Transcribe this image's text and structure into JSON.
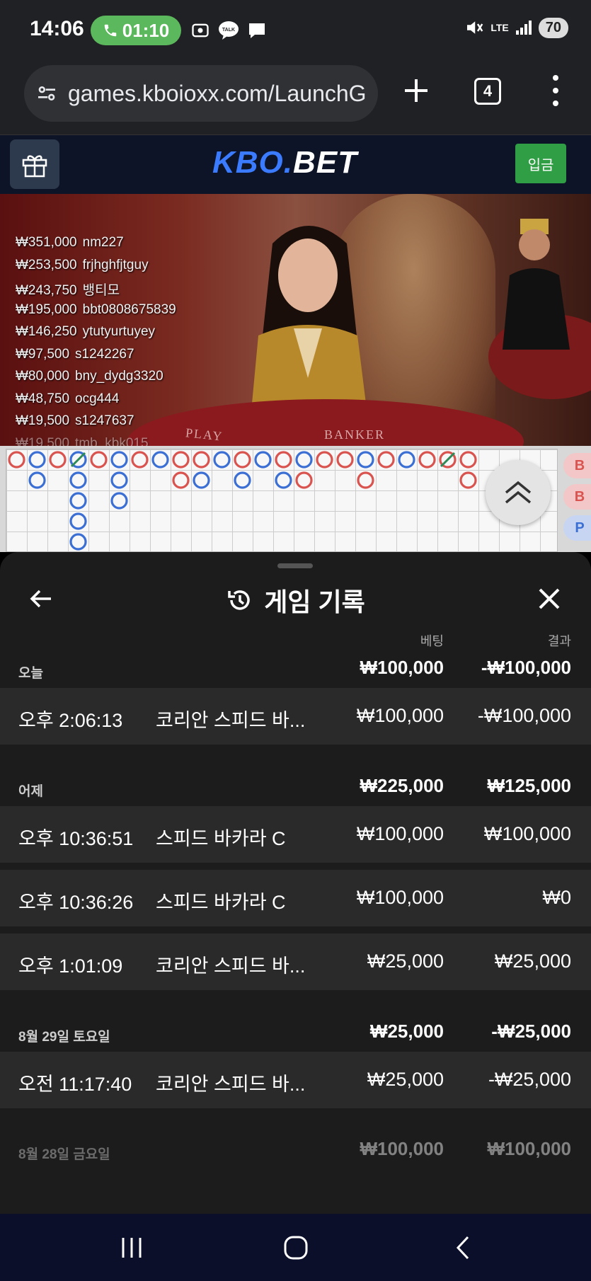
{
  "status_bar": {
    "time": "14:06",
    "call_timer": "01:10",
    "network": "LTE",
    "battery": "70"
  },
  "browser": {
    "url": "games.kboioxx.com/LaunchG",
    "tab_count": "4"
  },
  "site": {
    "logo_part1": "KBO.",
    "logo_part2": "BET",
    "deposit_label": "입금"
  },
  "video": {
    "bets": [
      {
        "amount": "₩351,000",
        "user": "nm227"
      },
      {
        "amount": "₩253,500",
        "user": "frjhghfjtguy"
      },
      {
        "amount": "₩243,750",
        "user": "뱅티모"
      },
      {
        "amount": "₩195,000",
        "user": "bbt0808675839"
      },
      {
        "amount": "₩146,250",
        "user": "ytutyurtuyey"
      },
      {
        "amount": "₩97,500",
        "user": "s1242267"
      },
      {
        "amount": "₩80,000",
        "user": "bny_dydg3320"
      },
      {
        "amount": "₩48,750",
        "user": "ocg444"
      },
      {
        "amount": "₩19,500",
        "user": "s1247637"
      },
      {
        "amount": "₩19,500",
        "user": "tmb_kbk015"
      }
    ],
    "player_label": "PLAY",
    "banker_label": "BANKER"
  },
  "road": {
    "side_pills": [
      {
        "label": "B",
        "color": "#d9534f"
      },
      {
        "label": "B",
        "color": "#d9534f"
      },
      {
        "label": "P",
        "color": "#3b6fd4"
      }
    ]
  },
  "history": {
    "title": "게임 기록",
    "col_bet": "베팅",
    "col_result": "결과",
    "groups": [
      {
        "label": "오늘",
        "bet": "₩100,000",
        "result": "-₩100,000",
        "rows": [
          {
            "time": "오후 2:06:13",
            "game": "코리안 스피드 바...",
            "bet": "₩100,000",
            "result": "-₩100,000"
          }
        ]
      },
      {
        "label": "어제",
        "bet": "₩225,000",
        "result": "₩125,000",
        "rows": [
          {
            "time": "오후 10:36:51",
            "game": "스피드 바카라 C",
            "bet": "₩100,000",
            "result": "₩100,000"
          },
          {
            "time": "오후 10:36:26",
            "game": "스피드 바카라 C",
            "bet": "₩100,000",
            "result": "₩0"
          },
          {
            "time": "오후 1:01:09",
            "game": "코리안 스피드 바...",
            "bet": "₩25,000",
            "result": "₩25,000"
          }
        ]
      },
      {
        "label": "8월 29일 토요일",
        "bet": "₩25,000",
        "result": "-₩25,000",
        "rows": [
          {
            "time": "오전 11:17:40",
            "game": "코리안 스피드 바...",
            "bet": "₩25,000",
            "result": "-₩25,000"
          }
        ]
      },
      {
        "label": "8월 28일 금요일",
        "bet": "₩100,000",
        "result": "₩100,000",
        "rows": []
      }
    ]
  },
  "colors": {
    "player_blue": "#3b6fd4",
    "banker_red": "#d9534f",
    "tie_green": "#2e8b57",
    "deposit_green": "#2f9e44",
    "logo_blue": "#3a7bff"
  }
}
